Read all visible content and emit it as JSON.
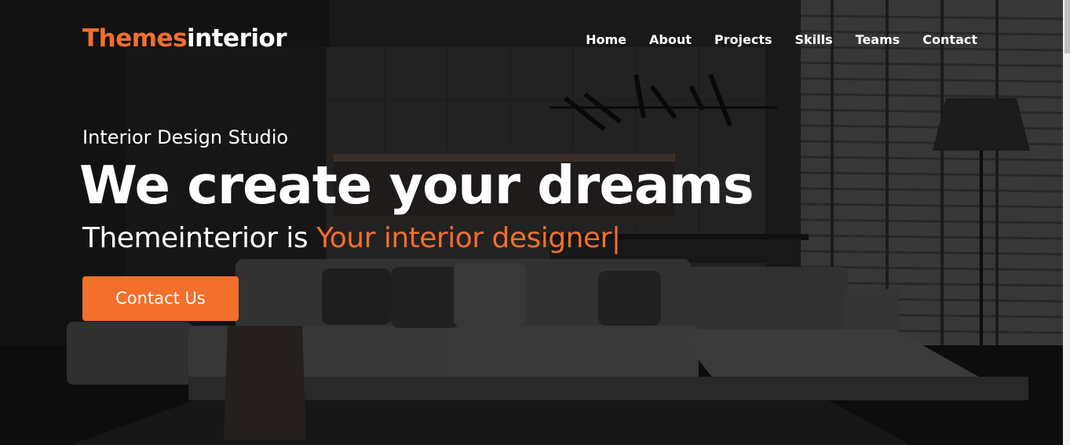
{
  "brand": {
    "logo_accent": "Themes",
    "logo_rest": "interior",
    "accent_color": "#f26f2c"
  },
  "nav": {
    "items": [
      {
        "label": "Home"
      },
      {
        "label": "About"
      },
      {
        "label": "Projects"
      },
      {
        "label": "Skills"
      },
      {
        "label": "Teams"
      },
      {
        "label": "Contact"
      }
    ]
  },
  "hero": {
    "eyebrow": "Interior Design Studio",
    "headline": "We create your dreams",
    "tagline_prefix": "Themeinterior is ",
    "tagline_typed": "Your interior designer",
    "tagline_cursor": "|",
    "cta_label": "Contact Us"
  }
}
